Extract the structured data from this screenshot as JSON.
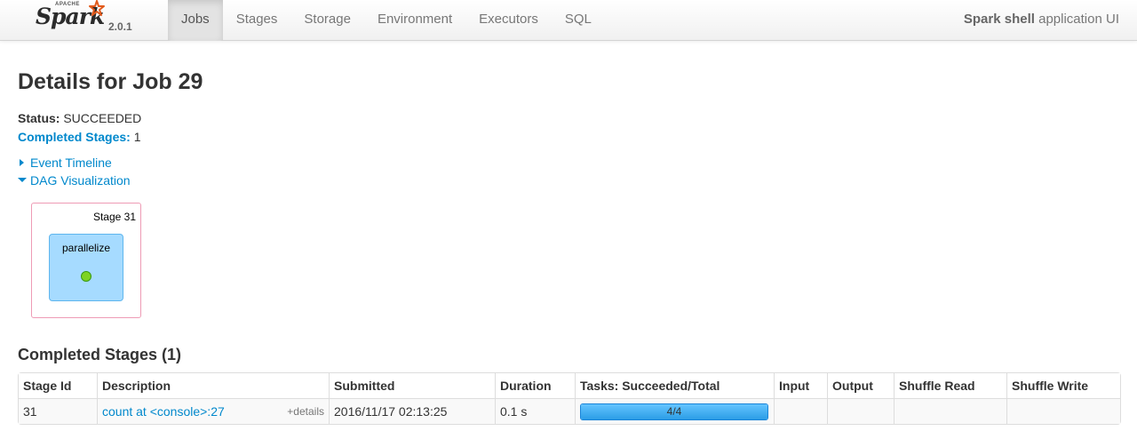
{
  "brand": {
    "apache": "APACHE",
    "name": "Spark",
    "version": "2.0.1"
  },
  "nav": {
    "tabs": [
      {
        "label": "Jobs",
        "active": true
      },
      {
        "label": "Stages",
        "active": false
      },
      {
        "label": "Storage",
        "active": false
      },
      {
        "label": "Environment",
        "active": false
      },
      {
        "label": "Executors",
        "active": false
      },
      {
        "label": "SQL",
        "active": false
      }
    ],
    "app_name": "Spark shell",
    "app_suffix": " application UI"
  },
  "page": {
    "title": "Details for Job 29",
    "status_label": "Status:",
    "status_value": "SUCCEEDED",
    "completed_label": "Completed Stages:",
    "completed_value": "1",
    "event_timeline": "Event Timeline",
    "dag_visualization": "DAG Visualization"
  },
  "dag": {
    "stage_label": "Stage 31",
    "rdd_label": "parallelize"
  },
  "table": {
    "title": "Completed Stages (1)",
    "headers": [
      "Stage Id",
      "Description",
      "Submitted",
      "Duration",
      "Tasks: Succeeded/Total",
      "Input",
      "Output",
      "Shuffle Read",
      "Shuffle Write"
    ],
    "rows": [
      {
        "stage_id": "31",
        "description": "count at <console>:27",
        "details": "+details",
        "submitted": "2016/11/17 02:13:25",
        "duration": "0.1 s",
        "tasks_text": "4/4",
        "tasks_fraction": 1.0,
        "input": "",
        "output": "",
        "shuffle_read": "",
        "shuffle_write": ""
      }
    ]
  },
  "colors": {
    "link": "#0088cc",
    "progress": "#2b9de6",
    "dag_stage_border": "#ee9bb5",
    "dag_rdd_fill": "#a6dbff",
    "dag_node": "#7ed321"
  }
}
